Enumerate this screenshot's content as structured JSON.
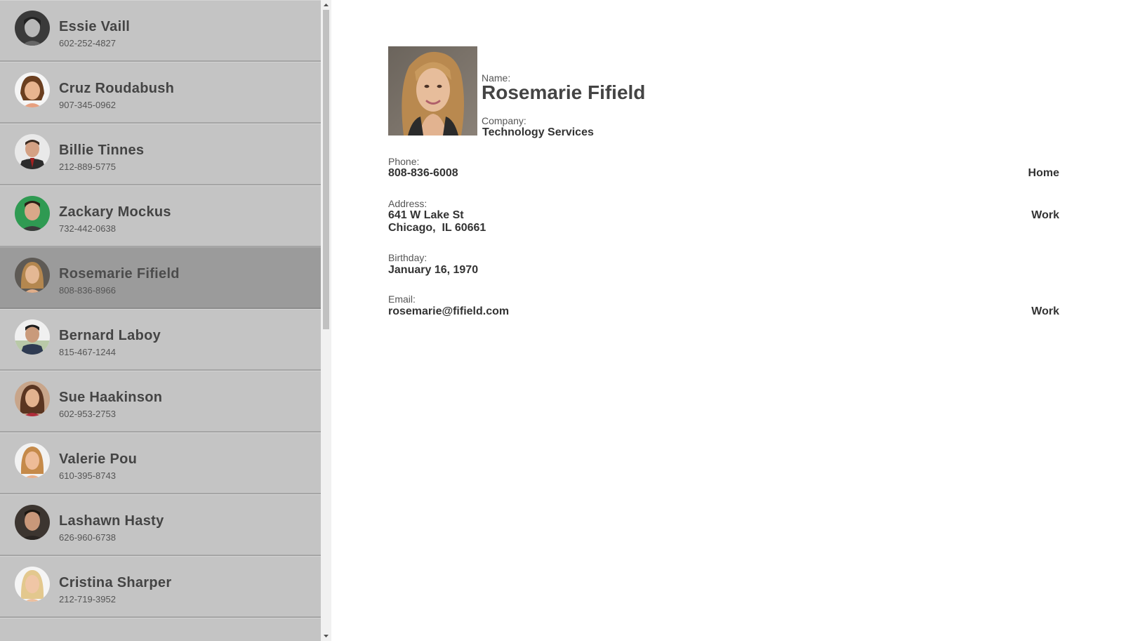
{
  "contacts": [
    {
      "name": "Essie Vaill",
      "phone": "602-252-4827"
    },
    {
      "name": "Cruz Roudabush",
      "phone": "907-345-0962"
    },
    {
      "name": "Billie Tinnes",
      "phone": "212-889-5775"
    },
    {
      "name": "Zackary Mockus",
      "phone": "732-442-0638"
    },
    {
      "name": "Rosemarie Fifield",
      "phone": "808-836-8966"
    },
    {
      "name": "Bernard Laboy",
      "phone": "815-467-1244"
    },
    {
      "name": "Sue Haakinson",
      "phone": "602-953-2753"
    },
    {
      "name": "Valerie Pou",
      "phone": "610-395-8743"
    },
    {
      "name": "Lashawn Hasty",
      "phone": "626-960-6738"
    },
    {
      "name": "Cristina Sharper",
      "phone": "212-719-3952"
    }
  ],
  "detail": {
    "name_label": "Name:",
    "name": "Rosemarie Fifield",
    "company_label": "Company:",
    "company": "Technology Services",
    "phone_label": "Phone:",
    "phone": "808-836-6008",
    "phone_type": "Home",
    "address_label": "Address:",
    "address_line1": "641 W Lake St",
    "address_line2": "Chicago,  IL 60661",
    "address_type": "Work",
    "birthday_label": "Birthday:",
    "birthday": "January 16, 1970",
    "email_label": "Email:",
    "email": "rosemarie@fifield.com",
    "email_type": "Work"
  },
  "colors": {
    "sidebar_bg": "#c4c4c4",
    "selected_bg": "#9b9b9b",
    "divider": "#a5a5a5"
  }
}
